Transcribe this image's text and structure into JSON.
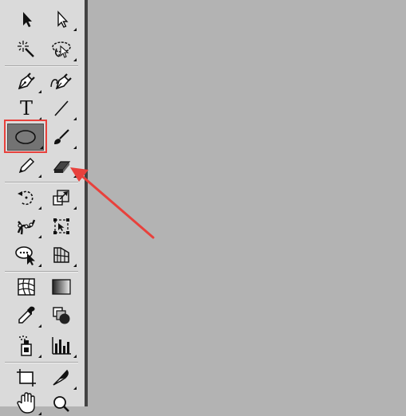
{
  "colors": {
    "canvas": "#b3b3b3",
    "toolbar": "#dadada",
    "separator": "#434343",
    "highlight": "#e8413c",
    "annotation_arrow": "#e8413c",
    "selected_tool_bg": "#737373"
  },
  "toolbar": {
    "tools": [
      {
        "icon": "selection-arrow-icon"
      },
      {
        "icon": "direct-selection-icon"
      },
      {
        "icon": "magic-wand-icon"
      },
      {
        "icon": "lasso-icon"
      },
      {
        "icon": "pen-icon"
      },
      {
        "icon": "curvature-pen-icon"
      },
      {
        "icon": "type-icon",
        "glyph": "T"
      },
      {
        "icon": "line-segment-icon"
      },
      {
        "icon": "ellipse-icon",
        "selected": true,
        "highlighted": true
      },
      {
        "icon": "paintbrush-icon"
      },
      {
        "icon": "pencil-icon"
      },
      {
        "icon": "eraser-icon"
      },
      {
        "icon": "rotate-icon"
      },
      {
        "icon": "scale-icon"
      },
      {
        "icon": "puppet-warp-icon"
      },
      {
        "icon": "free-transform-icon"
      },
      {
        "icon": "shape-builder-icon"
      },
      {
        "icon": "perspective-grid-icon"
      },
      {
        "icon": "mesh-icon"
      },
      {
        "icon": "gradient-icon"
      },
      {
        "icon": "eyedropper-icon"
      },
      {
        "icon": "blend-icon"
      },
      {
        "icon": "symbol-sprayer-icon"
      },
      {
        "icon": "column-graph-icon"
      },
      {
        "icon": "artboard-icon"
      },
      {
        "icon": "slice-icon"
      },
      {
        "icon": "hand-icon"
      },
      {
        "icon": "zoom-icon"
      }
    ]
  },
  "annotation": {
    "points_to": "eraser-icon"
  }
}
